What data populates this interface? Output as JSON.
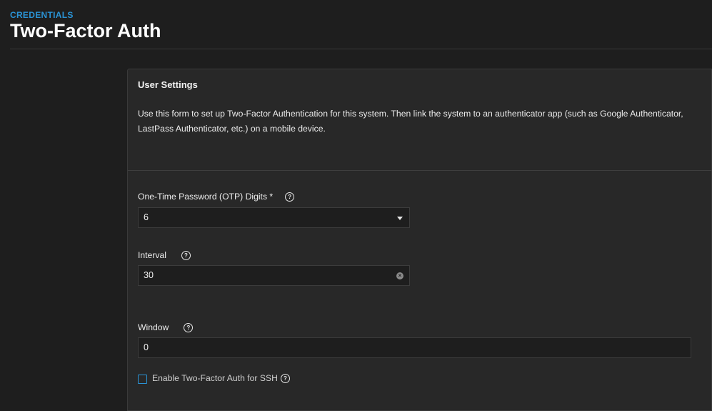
{
  "header": {
    "breadcrumb": "CREDENTIALS",
    "title": "Two-Factor Auth"
  },
  "card": {
    "title": "User Settings",
    "description": "Use this form to set up Two-Factor Authentication for this system. Then link the system to an authenticator app (such as Google Authenticator, LastPass Authenticator, etc.) on a mobile device."
  },
  "fields": {
    "otp_digits": {
      "label": "One-Time Password (OTP) Digits *",
      "value": "6",
      "help_icon": "help-icon"
    },
    "interval": {
      "label": "Interval",
      "value": "30",
      "help_icon": "help-icon"
    },
    "window": {
      "label": "Window",
      "value": "0",
      "help_icon": "help-icon"
    },
    "ssh": {
      "label": "Enable Two-Factor Auth for SSH",
      "checked": false,
      "help_icon": "help-icon"
    }
  },
  "icons": {
    "help_glyph": "?",
    "clear_glyph": "×"
  },
  "colors": {
    "accent": "#2a93d5",
    "background": "#1e1e1e",
    "card": "#282828"
  }
}
